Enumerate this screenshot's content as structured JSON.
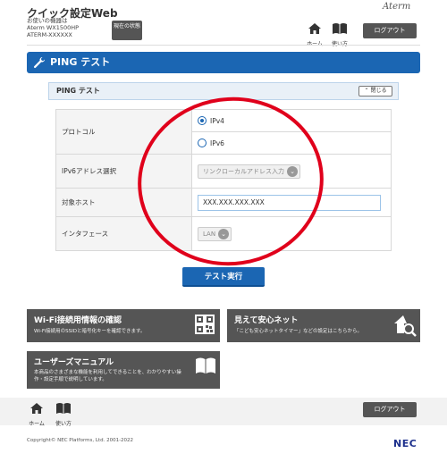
{
  "header": {
    "app_title": "クイック設定Web",
    "device_label": "お使いの機器は",
    "device_model": "Aterm  WX1500HP",
    "device_id": "ATERM-XXXXXX",
    "status_button": "現在の状態",
    "brand": "Aterm",
    "nav_home": "ホーム",
    "nav_manual": "使い方",
    "logout": "ログアウト"
  },
  "page": {
    "title": "PING テスト"
  },
  "section": {
    "title": "PING テスト",
    "collapse": "閉じる"
  },
  "form": {
    "protocol_label": "プロトコル",
    "protocol_options": [
      "IPv4",
      "IPv6"
    ],
    "protocol_selected": "IPv4",
    "ipv6_label": "IPv6アドレス選択",
    "ipv6_value": "リンクローカルアドレス入力",
    "host_label": "対象ホスト",
    "host_value": "XXX.XXX.XXX.XXX",
    "interface_label": "インタフェース",
    "interface_value": "LAN"
  },
  "actions": {
    "run": "テスト実行"
  },
  "tiles": {
    "wifi_title": "Wi-Fi接続用情報の確認",
    "wifi_desc": "Wi-Fi接続用のSSIDと暗号化キーを確認できます。",
    "safe_title": "見えて安心ネット",
    "safe_desc": "「こども安心ネットタイマー」などの設定はこちらから。",
    "manual_title": "ユーザーズマニュアル",
    "manual_desc_1": "本商品のさまざまな機能を利用してできることを、わかりやすい操",
    "manual_desc_2": "作・設定手順で説明しています。"
  },
  "footer": {
    "nav_home": "ホーム",
    "nav_manual": "使い方",
    "logout": "ログアウト",
    "copyright": "Copyright© NEC Platforms, Ltd. 2001-2022",
    "brand": "NEC"
  },
  "colors": {
    "primary": "#1b66b3",
    "tile": "#555555",
    "annotation": "#e0001b"
  }
}
